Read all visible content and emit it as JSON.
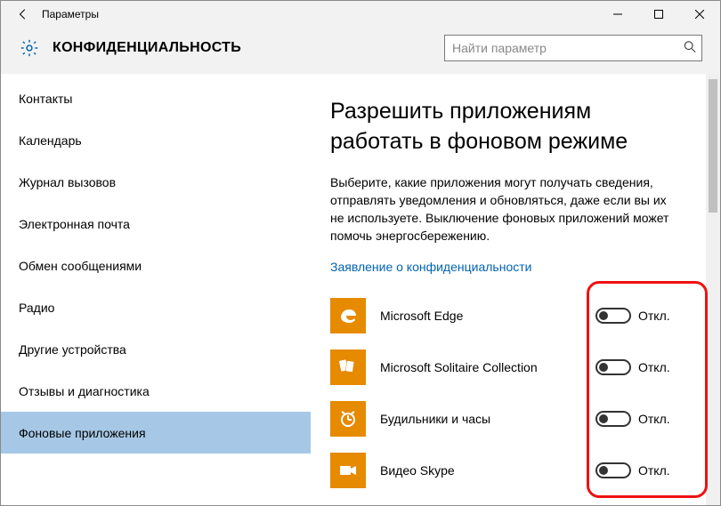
{
  "window": {
    "title": "Параметры"
  },
  "header": {
    "title": "КОНФИДЕНЦИАЛЬНОСТЬ",
    "search_placeholder": "Найти параметр"
  },
  "sidebar": {
    "items": [
      {
        "label": "Контакты",
        "selected": false
      },
      {
        "label": "Календарь",
        "selected": false
      },
      {
        "label": "Журнал вызовов",
        "selected": false
      },
      {
        "label": "Электронная почта",
        "selected": false
      },
      {
        "label": "Обмен сообщениями",
        "selected": false
      },
      {
        "label": "Радио",
        "selected": false
      },
      {
        "label": "Другие устройства",
        "selected": false
      },
      {
        "label": "Отзывы и диагностика",
        "selected": false
      },
      {
        "label": "Фоновые приложения",
        "selected": true
      }
    ]
  },
  "main": {
    "heading": "Разрешить приложениям работать в фоновом режиме",
    "description": "Выберите, какие приложения могут получать сведения, отправлять уведомления и обновляться, даже если вы их не используете. Выключение фоновых приложений может помочь энергосбережению.",
    "privacy_link": "Заявление о конфиденциальности",
    "apps": [
      {
        "name": "Microsoft Edge",
        "state": "Откл.",
        "icon": "edge"
      },
      {
        "name": "Microsoft Solitaire Collection",
        "state": "Откл.",
        "icon": "solitaire"
      },
      {
        "name": "Будильники и часы",
        "state": "Откл.",
        "icon": "alarm"
      },
      {
        "name": "Видео Skype",
        "state": "Откл.",
        "icon": "video"
      }
    ]
  }
}
